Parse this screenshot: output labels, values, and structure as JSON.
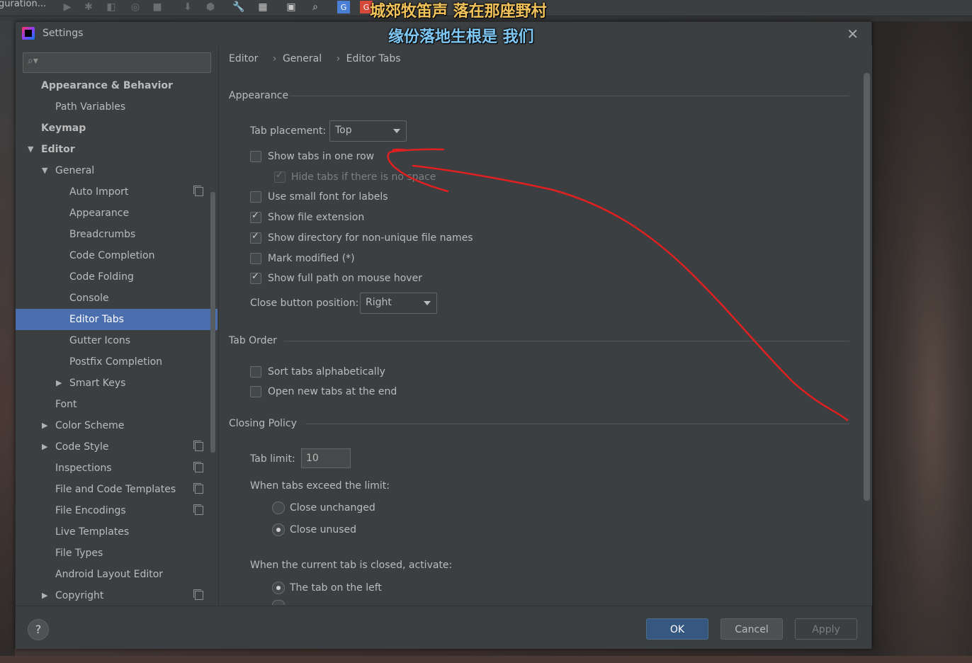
{
  "toolbar": {
    "run_config": "guration...",
    "icons": [
      "run-icon",
      "debug-icon",
      "coverage-icon",
      "profile-icon",
      "stop-icon",
      "build-icon",
      "sdk-icon",
      "settings-icon",
      "structure-icon",
      "terminal-icon",
      "search-icon",
      "translate-icon",
      "translate-red-icon"
    ]
  },
  "overlay": {
    "line1": "城郊牧笛声 落在那座野村",
    "line2": "缘份落地生根是 我们"
  },
  "dialog": {
    "title": "Settings",
    "search": {
      "value": "",
      "placeholder": ""
    },
    "tree": [
      {
        "label": "Appearance & Behavior",
        "level": 0,
        "bold": true,
        "arrow": "",
        "proj": false
      },
      {
        "label": "Path Variables",
        "level": 1,
        "bold": false,
        "arrow": "",
        "proj": false
      },
      {
        "label": "Keymap",
        "level": 0,
        "bold": true,
        "arrow": "",
        "proj": false
      },
      {
        "label": "Editor",
        "level": 0,
        "bold": true,
        "arrow": "down",
        "proj": false
      },
      {
        "label": "General",
        "level": 1,
        "bold": false,
        "arrow": "down",
        "proj": false
      },
      {
        "label": "Auto Import",
        "level": 2,
        "bold": false,
        "arrow": "",
        "proj": true
      },
      {
        "label": "Appearance",
        "level": 2,
        "bold": false,
        "arrow": "",
        "proj": false
      },
      {
        "label": "Breadcrumbs",
        "level": 2,
        "bold": false,
        "arrow": "",
        "proj": false
      },
      {
        "label": "Code Completion",
        "level": 2,
        "bold": false,
        "arrow": "",
        "proj": false
      },
      {
        "label": "Code Folding",
        "level": 2,
        "bold": false,
        "arrow": "",
        "proj": false
      },
      {
        "label": "Console",
        "level": 2,
        "bold": false,
        "arrow": "",
        "proj": false
      },
      {
        "label": "Editor Tabs",
        "level": 2,
        "bold": false,
        "arrow": "",
        "proj": false,
        "selected": true
      },
      {
        "label": "Gutter Icons",
        "level": 2,
        "bold": false,
        "arrow": "",
        "proj": false
      },
      {
        "label": "Postfix Completion",
        "level": 2,
        "bold": false,
        "arrow": "",
        "proj": false
      },
      {
        "label": "Smart Keys",
        "level": 2,
        "bold": false,
        "arrow": "right",
        "proj": false
      },
      {
        "label": "Font",
        "level": 1,
        "bold": false,
        "arrow": "",
        "proj": false
      },
      {
        "label": "Color Scheme",
        "level": 1,
        "bold": false,
        "arrow": "right",
        "proj": false
      },
      {
        "label": "Code Style",
        "level": 1,
        "bold": false,
        "arrow": "right",
        "proj": true
      },
      {
        "label": "Inspections",
        "level": 1,
        "bold": false,
        "arrow": "",
        "proj": true
      },
      {
        "label": "File and Code Templates",
        "level": 1,
        "bold": false,
        "arrow": "",
        "proj": true
      },
      {
        "label": "File Encodings",
        "level": 1,
        "bold": false,
        "arrow": "",
        "proj": true
      },
      {
        "label": "Live Templates",
        "level": 1,
        "bold": false,
        "arrow": "",
        "proj": false
      },
      {
        "label": "File Types",
        "level": 1,
        "bold": false,
        "arrow": "",
        "proj": false
      },
      {
        "label": "Android Layout Editor",
        "level": 1,
        "bold": false,
        "arrow": "",
        "proj": false
      },
      {
        "label": "Copyright",
        "level": 1,
        "bold": false,
        "arrow": "right",
        "proj": true
      }
    ],
    "breadcrumb": [
      "Editor",
      "General",
      "Editor Tabs"
    ],
    "breadcrumb_sep": "›",
    "appearance": {
      "title": "Appearance",
      "tab_placement_label": "Tab placement:",
      "tab_placement_value": "Top",
      "show_tabs_one_row": {
        "label": "Show tabs in one row",
        "checked": false
      },
      "hide_tabs_no_space": {
        "label": "Hide tabs if there is no space",
        "checked": true,
        "disabled": true
      },
      "small_font": {
        "label": "Use small font for labels",
        "checked": false
      },
      "show_ext": {
        "label": "Show file extension",
        "checked": true
      },
      "show_dir": {
        "label": "Show directory for non-unique file names",
        "checked": true
      },
      "mark_modified": {
        "label": "Mark modified (*)",
        "checked": false
      },
      "full_path": {
        "label": "Show full path on mouse hover",
        "checked": true
      },
      "close_btn_label": "Close button position:",
      "close_btn_value": "Right"
    },
    "tab_order": {
      "title": "Tab Order",
      "sort_alpha": {
        "label": "Sort tabs alphabetically",
        "checked": false
      },
      "open_end": {
        "label": "Open new tabs at the end",
        "checked": false
      }
    },
    "closing": {
      "title": "Closing Policy",
      "tab_limit_label": "Tab limit:",
      "tab_limit_value": "10",
      "exceed_label": "When tabs exceed the limit:",
      "close_unchanged": {
        "label": "Close unchanged",
        "selected": false
      },
      "close_unused": {
        "label": "Close unused",
        "selected": true
      },
      "activate_label": "When the current tab is closed, activate:",
      "tab_left": {
        "label": "The tab on the left",
        "selected": true
      }
    },
    "buttons": {
      "help": "?",
      "ok": "OK",
      "cancel": "Cancel",
      "apply": "Apply"
    }
  },
  "colors": {
    "accent": "#4b6eaf",
    "ok_button": "#365880",
    "annotation": "#e02020"
  }
}
